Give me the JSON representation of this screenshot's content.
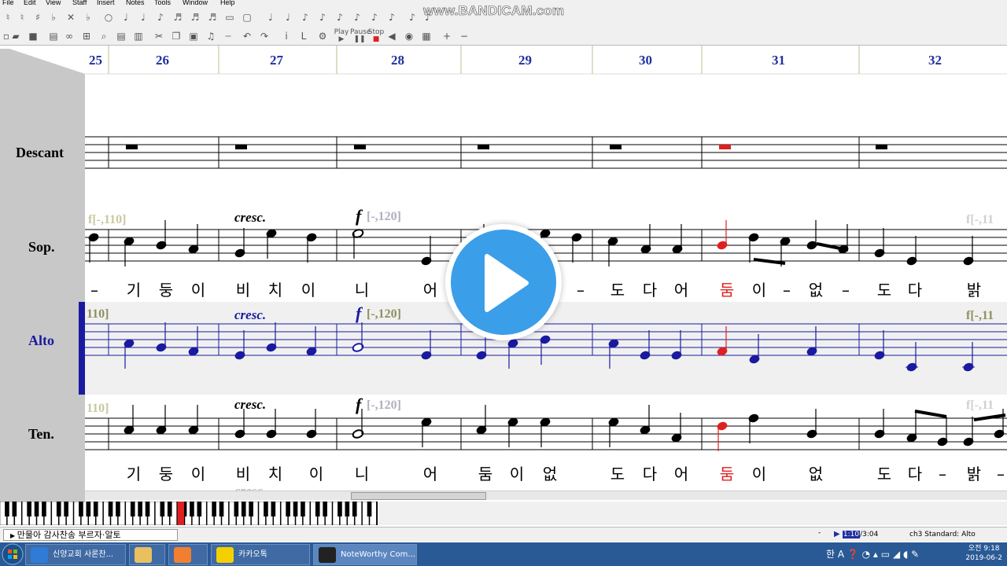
{
  "menu": [
    "File",
    "Edit",
    "View",
    "Staff",
    "Insert",
    "Notes",
    "Tools",
    "Window",
    "Help"
  ],
  "watermark": "www.BANDICAM.com",
  "toolbar": {
    "play": "Play",
    "pause": "Pause",
    "stop": "Stop"
  },
  "measures": [
    "25",
    "26",
    "27",
    "28",
    "29",
    "30",
    "31",
    "32"
  ],
  "staves": {
    "descant": {
      "name": "Descant"
    },
    "soprano": {
      "name": "Sop.",
      "tempo_left": "f[-,110]",
      "cresc": "cresc.",
      "tempo_mid": "[-,120]",
      "tempo_right": "f[-,11",
      "lyrics": [
        "–",
        "기",
        "둥",
        "이",
        "비",
        "치",
        "이",
        "니",
        "어",
        "–",
        "도",
        "다",
        "어",
        "둠",
        "이",
        "–",
        "없",
        "–",
        "도",
        "다",
        "밝"
      ]
    },
    "alto": {
      "name": "Alto",
      "tempo_left": "110]",
      "cresc": "cresc.",
      "tempo_mid": "[-,120]",
      "tempo_right": "f[-,11"
    },
    "tenor": {
      "name": "Ten.",
      "tempo_left": "110]",
      "cresc": "cresc.",
      "tempo_mid": "[-,120]",
      "tempo_right": "f[-,11",
      "lyrics": [
        "기",
        "둥",
        "이",
        "비",
        "치",
        "이",
        "니",
        "어",
        "둠",
        "이",
        "없",
        "도",
        "다",
        "어",
        "둠",
        "이",
        "없",
        "도",
        "다",
        "–",
        "밝",
        "–"
      ]
    },
    "bass": {
      "cresc": "cresc"
    }
  },
  "status": {
    "text": "만물아 감사찬송 부르자·알토",
    "position": "-",
    "time_current": "1:10",
    "time_total": "3:04",
    "channel": "ch3 Standard: Alto"
  },
  "taskbar": {
    "tasks": [
      "신양교회 사론찬...",
      "카카오톡",
      "NoteWorthy Com..."
    ],
    "clock_time": "오전 9:18",
    "clock_date": "2019-06-2"
  },
  "colors": {
    "measure_number": "#2030a0",
    "alto_staff": "#1a1aa0",
    "highlight_note": "#e02020",
    "tempo_marker": "#909060"
  }
}
